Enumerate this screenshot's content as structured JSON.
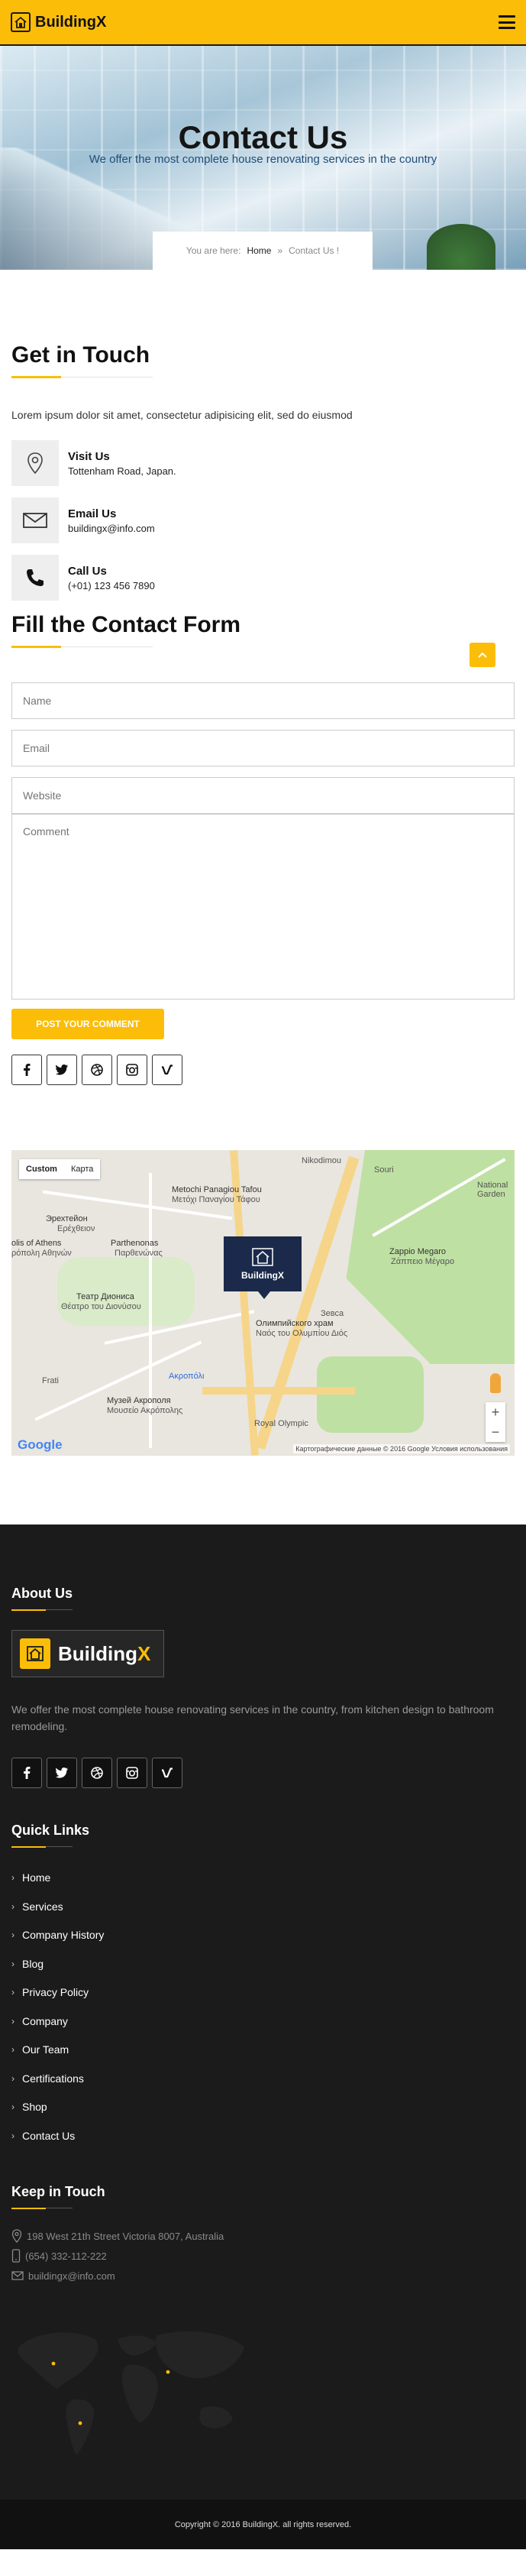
{
  "brand": {
    "name": "BuildingX",
    "name_main": "Building",
    "name_accent": "X",
    "accent_color": "#fbbd08",
    "dark_color": "#1b1b1b"
  },
  "hero": {
    "title": "Contact Us",
    "subtitle": "We offer the most complete house renovating services in the country",
    "breadcrumb": {
      "prefix": "You are here:",
      "home": "Home",
      "separator": "»",
      "current": "Contact Us !"
    }
  },
  "get_in_touch": {
    "title": "Get in Touch",
    "lead": "Lorem ipsum dolor sit amet, consectetur adipisicing elit, sed do eiusmod",
    "items": [
      {
        "icon": "map-pin-icon",
        "title": "Visit Us",
        "value": "Tottenham Road, Japan."
      },
      {
        "icon": "envelope-icon",
        "title": "Email Us",
        "value": "buildingx@info.com"
      },
      {
        "icon": "phone-icon",
        "title": "Call Us",
        "value": "(+01) 123 456 7890"
      }
    ]
  },
  "contact_form": {
    "title": "Fill the Contact Form",
    "placeholders": {
      "name": "Name",
      "email": "Email",
      "website": "Website",
      "comment": "Comment"
    },
    "submit": "POST YOUR COMMENT",
    "socials": [
      "facebook-icon",
      "twitter-icon",
      "dribbble-icon",
      "instagram-icon",
      "vimeo-icon"
    ]
  },
  "map": {
    "tabs": [
      "Custom",
      "Карта"
    ],
    "marker": "BuildingX",
    "labels": {
      "l1": "Metochi Panagiou Tafou",
      "l2": "Μετόχι Παναγίου Τάφου",
      "l3": "Эрехтейон",
      "l4": "Ερέχθειον",
      "l5": "Parthenonas",
      "l6": "Παρθενώνας",
      "l7": "olis of Athens",
      "l8": "ρόπολη Αθηνών",
      "l9": "Театр Диониса",
      "l10": "Θέατρο του Διονύσου",
      "l11": "Музей Акрополя",
      "l12": "Μουσείο Ακρόπολης",
      "l13": "Зевса",
      "l14": "Олимпийского храм",
      "l15": "Ναός του Ολυμπίου Διός",
      "l16": "Zappio Megaro",
      "l17": "Ζάππειο Μέγαρο",
      "l18": "National Garden",
      "l19": "Royal Olympic",
      "l20": "Frati",
      "l21": "Ακροπόλι",
      "l22": "Nikodimou",
      "l23": "Souri"
    },
    "zoom_in": "+",
    "zoom_out": "−",
    "google": "Google",
    "attribution": "Картографические данные © 2016 Google    Условия использования"
  },
  "footer": {
    "about_title": "About Us",
    "about_text": "We offer the most complete house renovating services in the country, from kitchen design to bathroom remodeling.",
    "socials": [
      "facebook-icon",
      "twitter-icon",
      "dribbble-icon",
      "instagram-icon",
      "vimeo-icon"
    ],
    "links_title": "Quick Links",
    "links": [
      "Home",
      "Services",
      "Company History",
      "Blog",
      "Privacy Policy",
      "Company",
      "Our Team",
      "Certifications",
      "Shop",
      "Contact Us"
    ],
    "keep_title": "Keep in Touch",
    "contacts": [
      {
        "icon": "map-pin-icon",
        "text": "198 West 21th Street Victoria 8007, Australia"
      },
      {
        "icon": "mobile-icon",
        "text": "(654) 332-112-222"
      },
      {
        "icon": "envelope-icon",
        "text": "buildingx@info.com"
      }
    ],
    "copyright": "Copyright © 2016 BuildingX. all rights reserved."
  }
}
